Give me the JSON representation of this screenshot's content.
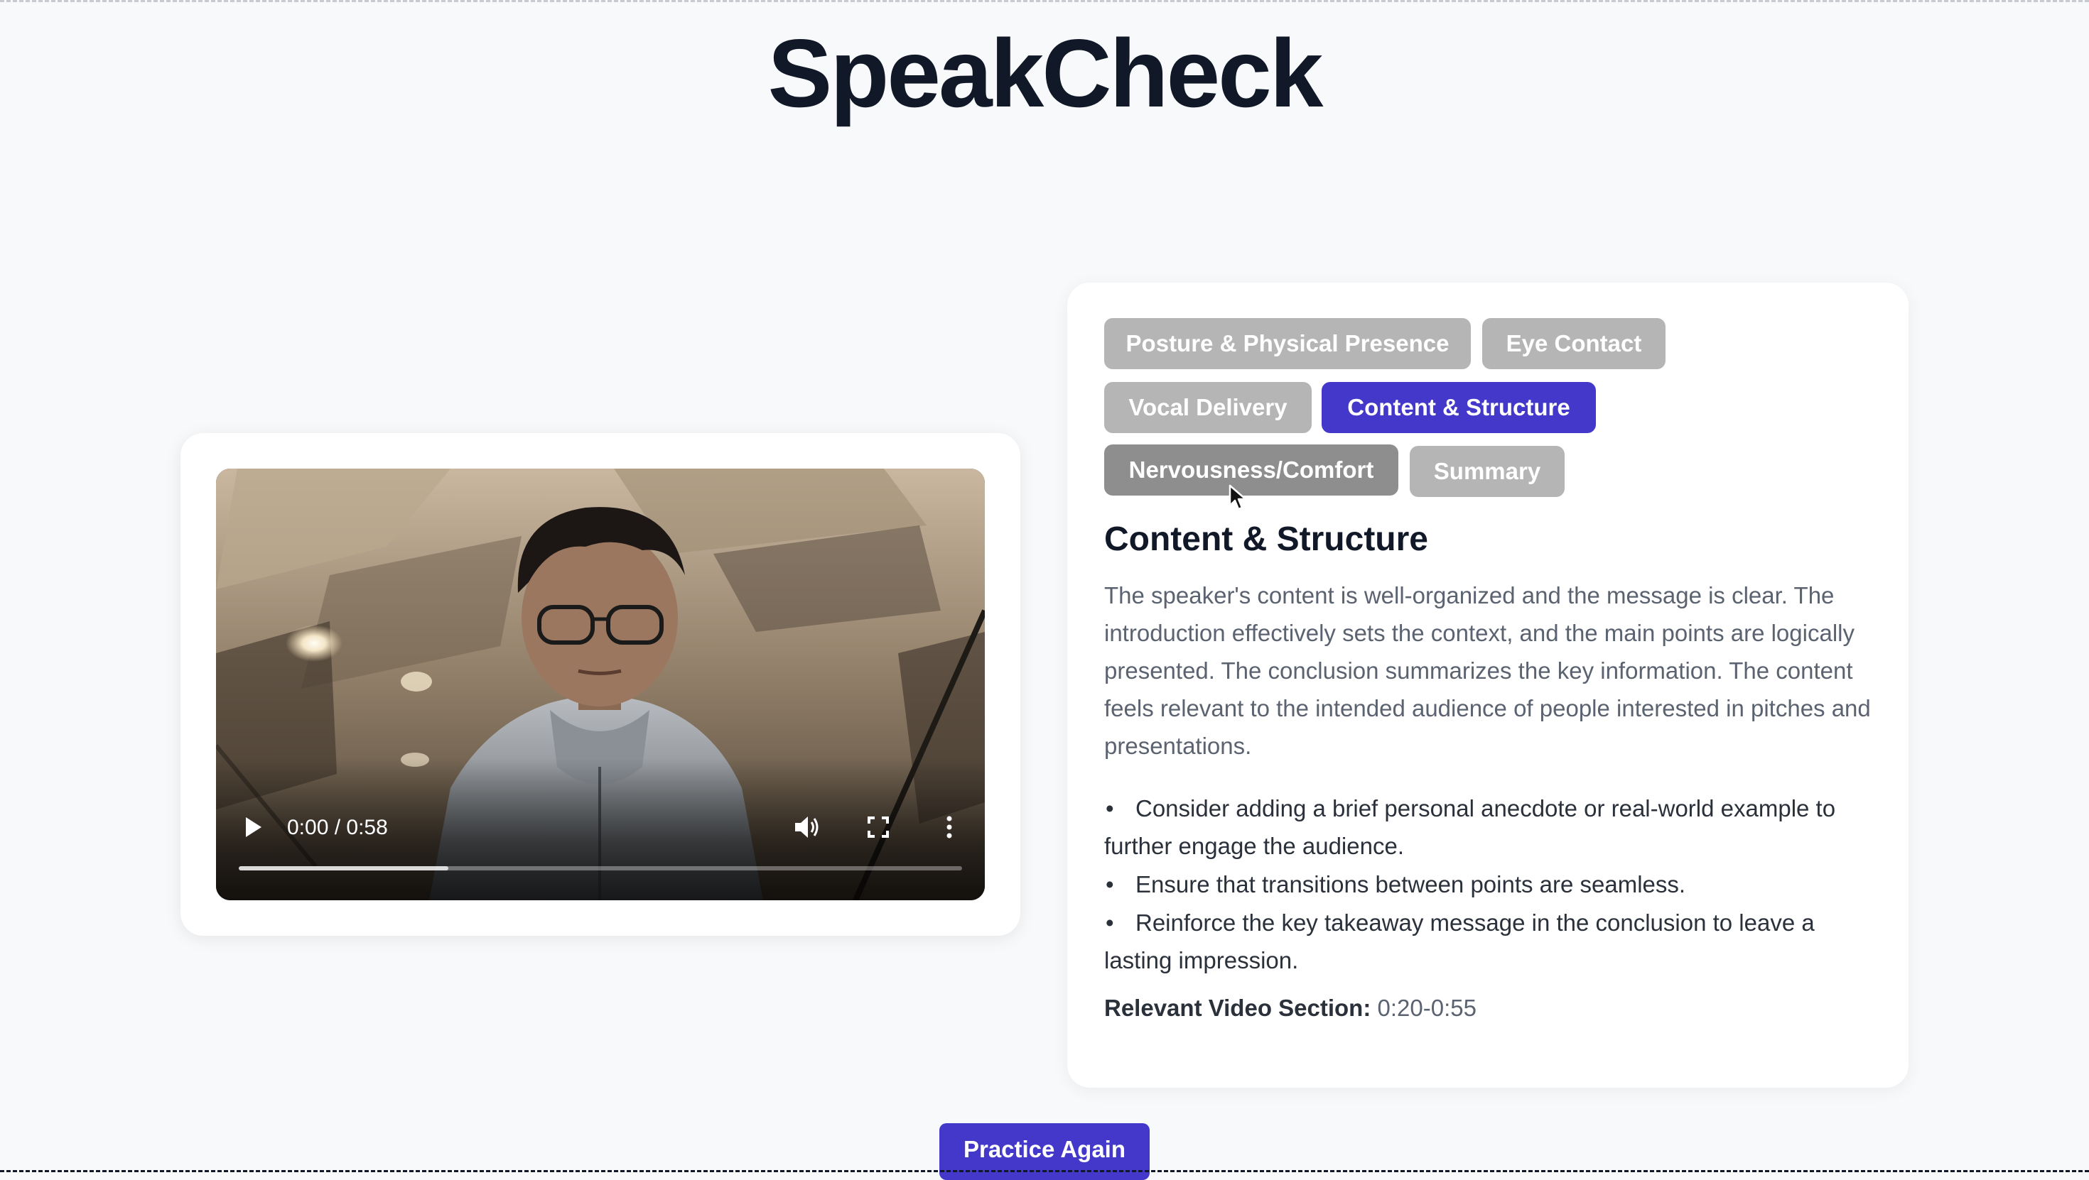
{
  "app": {
    "title": "SpeakCheck"
  },
  "video": {
    "current_time": "0:00",
    "duration": "0:58",
    "time_display": "0:00 / 0:58",
    "buffered_fraction": 0.29,
    "played_fraction": 0.0
  },
  "tabs": [
    {
      "label": "Posture & Physical Presence",
      "state": "inactive"
    },
    {
      "label": "Eye Contact",
      "state": "inactive"
    },
    {
      "label": "Vocal Delivery",
      "state": "inactive"
    },
    {
      "label": "Content & Structure",
      "state": "active"
    },
    {
      "label": "Nervousness/Comfort",
      "state": "hover"
    },
    {
      "label": "Summary",
      "state": "inactive"
    }
  ],
  "feedback": {
    "title": "Content & Structure",
    "description": "The speaker's content is well-organized and the message is clear. The introduction effectively sets the context, and the main points are logically presented. The conclusion summarizes the key information. The content feels relevant to the intended audience of people interested in pitches and presentations.",
    "suggestions": [
      "Consider adding a brief personal anecdote or real-world example to further engage the audience.",
      "Ensure that transitions between points are seamless.",
      "Reinforce the key takeaway message in the conclusion to leave a lasting impression."
    ],
    "bullet": "•",
    "relevant_label": "Relevant Video Section:",
    "relevant_value": "0:20-0:55"
  },
  "actions": {
    "practice_again": "Practice Again"
  },
  "colors": {
    "accent": "#4338ca",
    "tab_inactive": "#b5b5b5",
    "tab_hover": "#8e8e8e",
    "background": "#f8f9fb"
  },
  "icons": {
    "play": "play-icon",
    "volume": "volume-icon",
    "fullscreen": "fullscreen-icon",
    "more": "more-vertical-icon",
    "cursor": "mouse-pointer-icon"
  }
}
